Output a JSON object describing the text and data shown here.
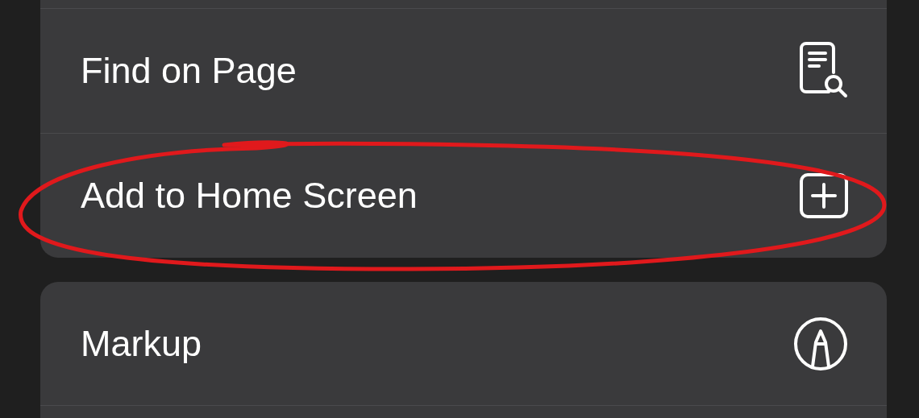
{
  "groups": [
    {
      "items": [
        {
          "label": "Find on Page"
        },
        {
          "label": "Add to Home Screen"
        }
      ]
    },
    {
      "items": [
        {
          "label": "Markup"
        }
      ]
    }
  ]
}
